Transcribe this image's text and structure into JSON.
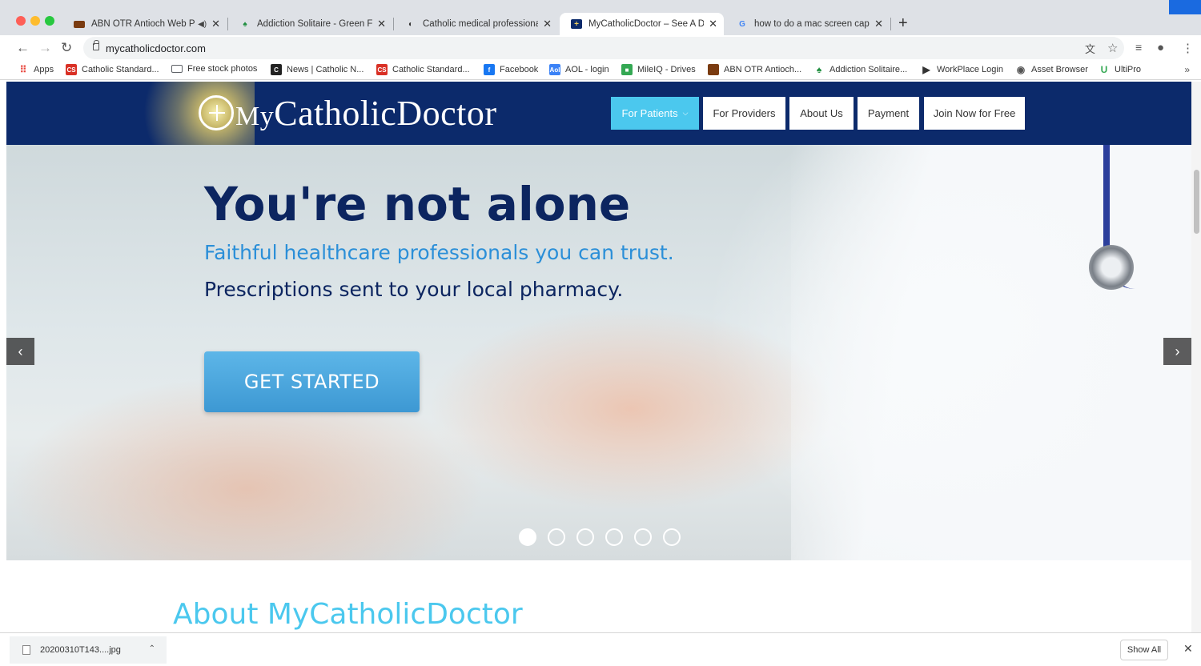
{
  "browser": {
    "tabs": [
      {
        "title": "ABN OTR Antioch Web Pla",
        "favicon": "book-icon",
        "audio": true
      },
      {
        "title": "Addiction Solitaire - Green Felt",
        "favicon": "spade-icon"
      },
      {
        "title": "Catholic medical professionals",
        "favicon": "site-icon"
      },
      {
        "title": "MyCatholicDoctor – See A Doc",
        "favicon": "mcd-icon",
        "active": true
      },
      {
        "title": "how to do a mac screen captur",
        "favicon": "google-icon"
      }
    ],
    "url": "mycatholicdoctor.com",
    "bookmarks": [
      {
        "label": "Apps",
        "icon": "apps-grid-icon",
        "color": "#e8453c"
      },
      {
        "label": "Catholic Standard...",
        "icon": "cs-icon",
        "color": "#d93025"
      },
      {
        "label": "Free stock photos",
        "icon": "folder-icon",
        "color": "#5f6368"
      },
      {
        "label": "News | Catholic N...",
        "icon": "cn-icon",
        "color": "#222222"
      },
      {
        "label": "Catholic Standard...",
        "icon": "cs-icon",
        "color": "#d93025"
      },
      {
        "label": "Facebook",
        "icon": "facebook-icon",
        "color": "#1877f2"
      },
      {
        "label": "AOL - login",
        "icon": "aol-icon",
        "color": "#3b82f6"
      },
      {
        "label": "MileIQ - Drives",
        "icon": "mileiq-icon",
        "color": "#34a853"
      },
      {
        "label": "ABN OTR Antioch...",
        "icon": "book-icon",
        "color": "#7a3b10"
      },
      {
        "label": "Addiction Solitaire...",
        "icon": "spade-icon",
        "color": "#1e8e3e"
      },
      {
        "label": "WorkPlace Login",
        "icon": "workplace-icon",
        "color": "#333333"
      },
      {
        "label": "Asset Browser",
        "icon": "globe-icon",
        "color": "#555555"
      },
      {
        "label": "UltiPro",
        "icon": "ultipro-icon",
        "color": "#34a853"
      }
    ]
  },
  "site": {
    "logo_my": "My",
    "logo_rest": "CatholicDoctor",
    "nav": [
      {
        "label": "For Patients",
        "active": true
      },
      {
        "label": "For Providers"
      },
      {
        "label": "About Us"
      },
      {
        "label": "Payment"
      },
      {
        "label": "Join Now for Free"
      }
    ],
    "hero": {
      "title": "You're not alone",
      "subtitle1": "Faithful healthcare professionals you can trust.",
      "subtitle2": "Prescriptions sent to your local pharmacy.",
      "cta": "GET STARTED",
      "slides": 6,
      "active_slide": 1
    },
    "about_heading": "About MyCatholicDoctor",
    "colors": {
      "navy": "#0c2a6b",
      "accent": "#4bc8ee",
      "cta": "#3d98d3",
      "title": "#0c2560",
      "subtitle": "#2b8fd8"
    }
  },
  "downloads": {
    "filename": "20200310T143....jpg",
    "show_all": "Show All"
  }
}
